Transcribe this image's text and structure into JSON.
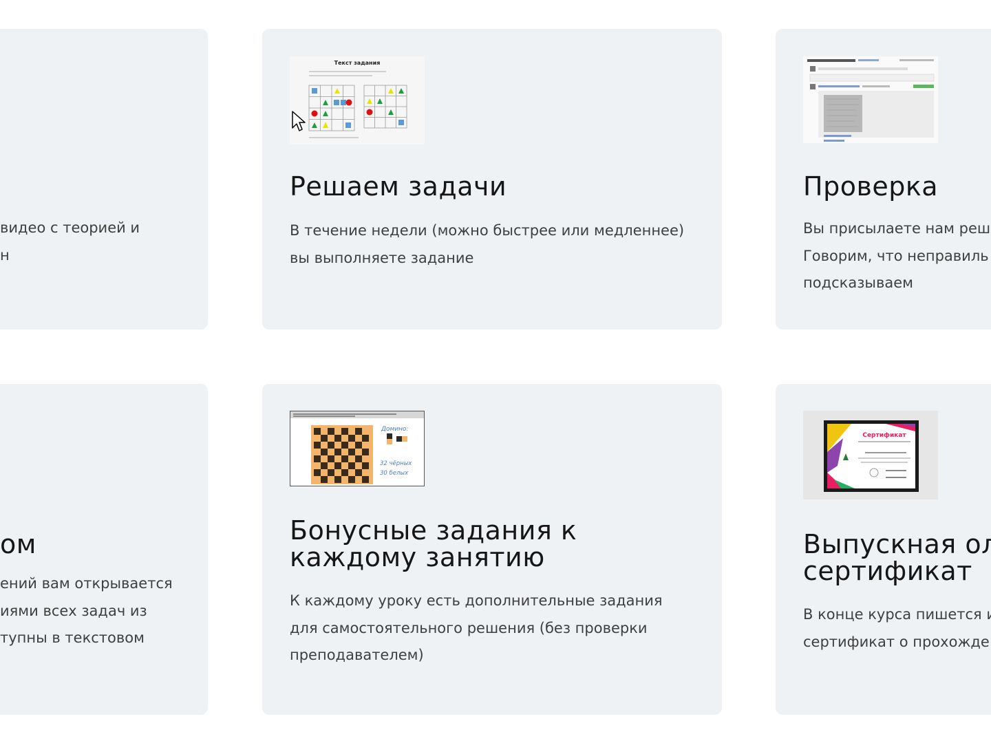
{
  "cards": [
    {
      "title": "",
      "text": "видео с теорией и\nн"
    },
    {
      "title": "Решаем задачи",
      "text": "В течение недели (можно быстрее или медленнее)\nвы выполняете задание",
      "thumbnail": {
        "icon": "task-sheet-image",
        "heading": "Текст задания"
      }
    },
    {
      "title": "Проверка",
      "text": "Вы присылаете нам реш\nГоворим, что неправиль\nподсказываем",
      "thumbnail": {
        "icon": "comments-screenshot-image"
      }
    },
    {
      "title": "ом",
      "text": "ений вам открывается\nиями всех задач из\nтупны в текстовом"
    },
    {
      "title": "Бонусные задания к\nкаждому занятию",
      "text": "К каждому уроку есть дополнительные задания\nдля самостоятельного решения (без проверки\nпреподавателем)",
      "thumbnail": {
        "icon": "chessboard-domino-image",
        "label": "Домино:",
        "note_line1": "32 чёрных",
        "note_line2": "30 белых"
      }
    },
    {
      "title": "Выпускная ол\nсертификат",
      "text": "В конце курса пишется и\nсертификат о прохожде",
      "thumbnail": {
        "icon": "certificate-image",
        "heading": "Сертификат"
      }
    }
  ],
  "colors": {
    "card_background": "#eff2f5",
    "page_background": "#ffffff",
    "title": "#161616",
    "text": "#3f3f3f"
  },
  "cursor_icon": "mouse-pointer-icon"
}
